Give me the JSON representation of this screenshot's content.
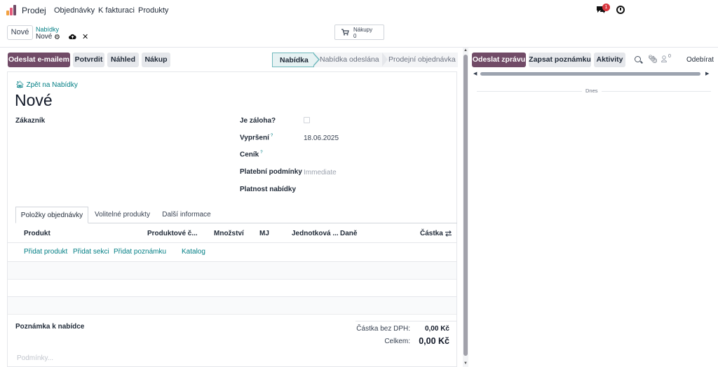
{
  "navbar": {
    "app_name": "Prodej",
    "menu": [
      "Objednávky",
      "K fakturaci",
      "Produkty"
    ],
    "messages_badge": "1",
    "colors": {
      "logo": [
        "#f1a240",
        "#e45a7b",
        "#714b67"
      ],
      "badge": "#d9363e"
    }
  },
  "control_panel": {
    "new_button": "Nové",
    "breadcrumb_parent": "Nabídky",
    "breadcrumb_current": "Nové",
    "stat_button": {
      "label": "Nákupy",
      "value": "0"
    }
  },
  "header_buttons": {
    "send_email": "Odeslat e-mailem",
    "confirm": "Potvrdit",
    "preview": "Náhled",
    "purchase": "Nákup"
  },
  "statusbar": {
    "stages": [
      "Nabídka",
      "Nabídka odeslána",
      "Prodejní objednávka"
    ],
    "active": "Nabídka"
  },
  "form": {
    "back_link": "Zpět na Nabídky",
    "title": "Nové",
    "left_fields": [
      {
        "label": "Zákazník",
        "value": ""
      }
    ],
    "right_fields": [
      {
        "label": "Je záloha?",
        "value": "",
        "type": "checkbox",
        "checked": false
      },
      {
        "label": "Vypršení",
        "value": "18.06.2025",
        "help": "?"
      },
      {
        "label": "Ceník",
        "value": "",
        "help": "?"
      },
      {
        "label": "Platební podmínky",
        "value": "Immediate"
      },
      {
        "label": "Platnost nabídky",
        "value": ""
      }
    ]
  },
  "tabs": [
    "Položky objednávky",
    "Volitelné produkty",
    "Další informace"
  ],
  "lines_table": {
    "columns": [
      "Produkt",
      "Produktové č...",
      "Množství",
      "MJ",
      "Jednotková ...",
      "Daně",
      "Částka"
    ],
    "add_links": [
      "Přidat produkt",
      "Přidat sekci",
      "Přidat poznámku",
      "Katalog"
    ],
    "rows": []
  },
  "totals": {
    "note_label": "Poznámka k nabídce",
    "note_placeholder": "Podmínky...",
    "untaxed_label": "Částka bez DPH:",
    "untaxed_value": "0,00 Kč",
    "total_label": "Celkem:",
    "total_value": "0,00 Kč"
  },
  "chatter": {
    "send_message": "Odeslat zprávu",
    "log_note": "Zapsat poznámku",
    "activities": "Aktivity",
    "followers_count": "0",
    "follow_label": "Odebírat",
    "today_label": "Dnes"
  },
  "colors": {
    "primary": "#714b67",
    "link": "#017e84",
    "secondary_button": "#e5e7eb"
  }
}
